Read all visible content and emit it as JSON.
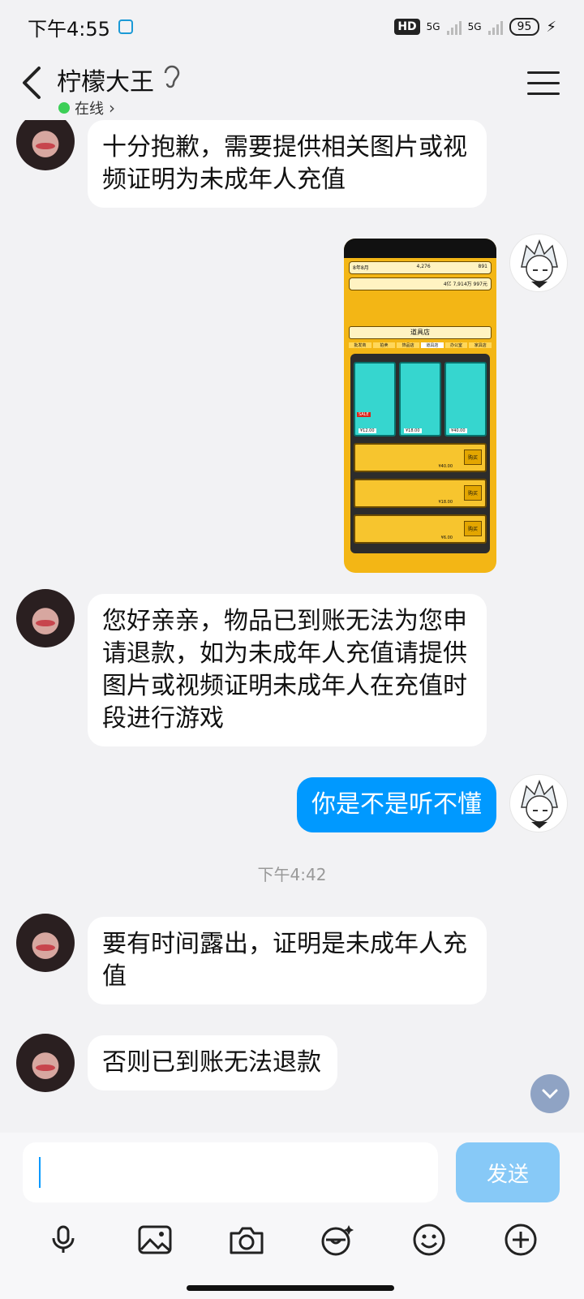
{
  "status_bar": {
    "time": "下午4:55",
    "network1": "5G",
    "network2": "5G",
    "hd": "HD",
    "battery": "95"
  },
  "header": {
    "title": "柠檬大王",
    "status": "在线"
  },
  "messages": [
    {
      "side": "left",
      "text": "十分抱歉，需要提供相关图片或视频证明为未成年人充值"
    },
    {
      "side": "right",
      "type": "image",
      "alt": "game-shop-screenshot"
    },
    {
      "side": "left",
      "text": "您好亲亲，物品已到账无法为您申请退款，如为未成年人充值请提供图片或视频证明未成年人在充值时段进行游戏"
    },
    {
      "side": "right",
      "text": "你是不是听不懂"
    },
    {
      "type": "time",
      "text": "下午4:42"
    },
    {
      "side": "left",
      "text": "要有时间露出，证明是未成年人充值"
    },
    {
      "side": "left",
      "text": "否则已到账无法退款"
    }
  ],
  "game_screenshot": {
    "stat1": "8年8月",
    "stat2": "4,276",
    "stat3": "891",
    "balance": "4亿 7,914万 997元",
    "shop_title": "道具店",
    "tabs": [
      "批发商",
      "拍卖",
      "饰品店",
      "道具店",
      "办公室",
      "家具店"
    ],
    "card_prices": [
      "¥12.00",
      "¥18.00",
      "¥40.00"
    ],
    "sale_label": "SALE",
    "buy_label": "购买",
    "row_prices": [
      "¥40.00",
      "¥18.00",
      "¥6.00"
    ]
  },
  "input": {
    "placeholder": "",
    "send_label": "发送"
  },
  "toolbar": [
    "mic-icon",
    "image-icon",
    "camera-icon",
    "sticker-icon",
    "emoji-icon",
    "plus-icon"
  ]
}
